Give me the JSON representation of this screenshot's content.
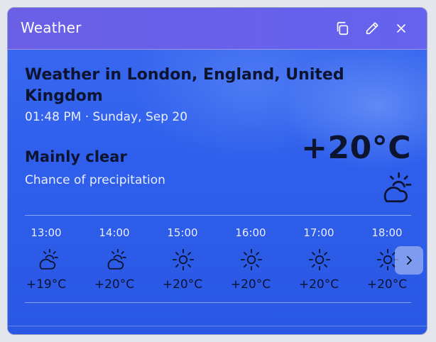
{
  "widget": {
    "title": "Weather",
    "actions": {
      "copy_icon": "copy-icon",
      "edit_icon": "pencil-icon",
      "close_icon": "close-icon"
    }
  },
  "weather": {
    "location_heading": "Weather in London, England, United Kingdom",
    "datetime": "01:48 PM · Sunday, Sep 20",
    "condition": "Mainly clear",
    "precipitation": "Chance of precipitation",
    "temperature": "+20°C",
    "icon": "partly-cloudy-icon"
  },
  "hourly": [
    {
      "time": "13:00",
      "temp": "+19°C",
      "icon": "partly-cloudy"
    },
    {
      "time": "14:00",
      "temp": "+20°C",
      "icon": "partly-cloudy"
    },
    {
      "time": "15:00",
      "temp": "+20°C",
      "icon": "sun"
    },
    {
      "time": "16:00",
      "temp": "+20°C",
      "icon": "sun"
    },
    {
      "time": "17:00",
      "temp": "+20°C",
      "icon": "sun"
    },
    {
      "time": "18:00",
      "temp": "+20°C",
      "icon": "sun"
    }
  ],
  "colors": {
    "header": "#6b5fe6",
    "body": "#3d6af0",
    "dark_text": "#0c1430",
    "light_text": "#e8eeff"
  }
}
